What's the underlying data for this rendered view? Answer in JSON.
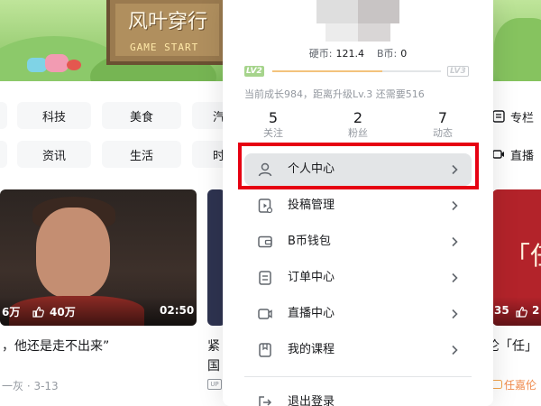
{
  "banner": {
    "sign_title": "风叶穿行",
    "sign_subtitle": "GAME START"
  },
  "categories": {
    "row1": [
      "科技",
      "美食",
      "汽"
    ],
    "row2": [
      "资讯",
      "生活",
      "时"
    ]
  },
  "feed": {
    "card1": {
      "views": "6万",
      "likes": "40万",
      "duration": "02:50",
      "title": "，他还是走不出来”",
      "meta": "一灰 · 3-13"
    },
    "card2": {
      "title_line1": "紧",
      "title_line2": "国",
      "badge": "UP"
    },
    "card3": {
      "overlay": "「任",
      "stat_a": "35",
      "stat_b": "2",
      "title": "伦「任」",
      "meta": "任嘉伦"
    }
  },
  "side_entries": [
    {
      "icon": "column-icon",
      "label": "专栏"
    },
    {
      "icon": "live-icon",
      "label": "直播"
    }
  ],
  "user_panel": {
    "coins": {
      "hard_label": "硬币:",
      "hard_value": "121.4",
      "bcoin_label": "B币:",
      "bcoin_value": "0"
    },
    "level": {
      "current": "LV2",
      "next": "LV3",
      "progress": 0.65,
      "tip": "当前成长984，距离升级Lv.3 还需要516"
    },
    "stats": [
      {
        "value": "5",
        "label": "关注"
      },
      {
        "value": "2",
        "label": "粉丝"
      },
      {
        "value": "7",
        "label": "动态"
      }
    ],
    "menu": [
      {
        "label": "个人中心",
        "icon": "user-icon",
        "active": true
      },
      {
        "label": "投稿管理",
        "icon": "upload-manage-icon",
        "active": false
      },
      {
        "label": "B币钱包",
        "icon": "wallet-icon",
        "active": false
      },
      {
        "label": "订单中心",
        "icon": "order-icon",
        "active": false
      },
      {
        "label": "直播中心",
        "icon": "live-center-icon",
        "active": false
      },
      {
        "label": "我的课程",
        "icon": "course-icon",
        "active": false
      }
    ],
    "logout": {
      "label": "退出登录",
      "icon": "logout-icon"
    }
  },
  "colors": {
    "highlight": "#e60012",
    "level_current": "#a6d48c",
    "progress_fill": "#f3c37c",
    "active_item_bg": "#e3e5e7"
  }
}
